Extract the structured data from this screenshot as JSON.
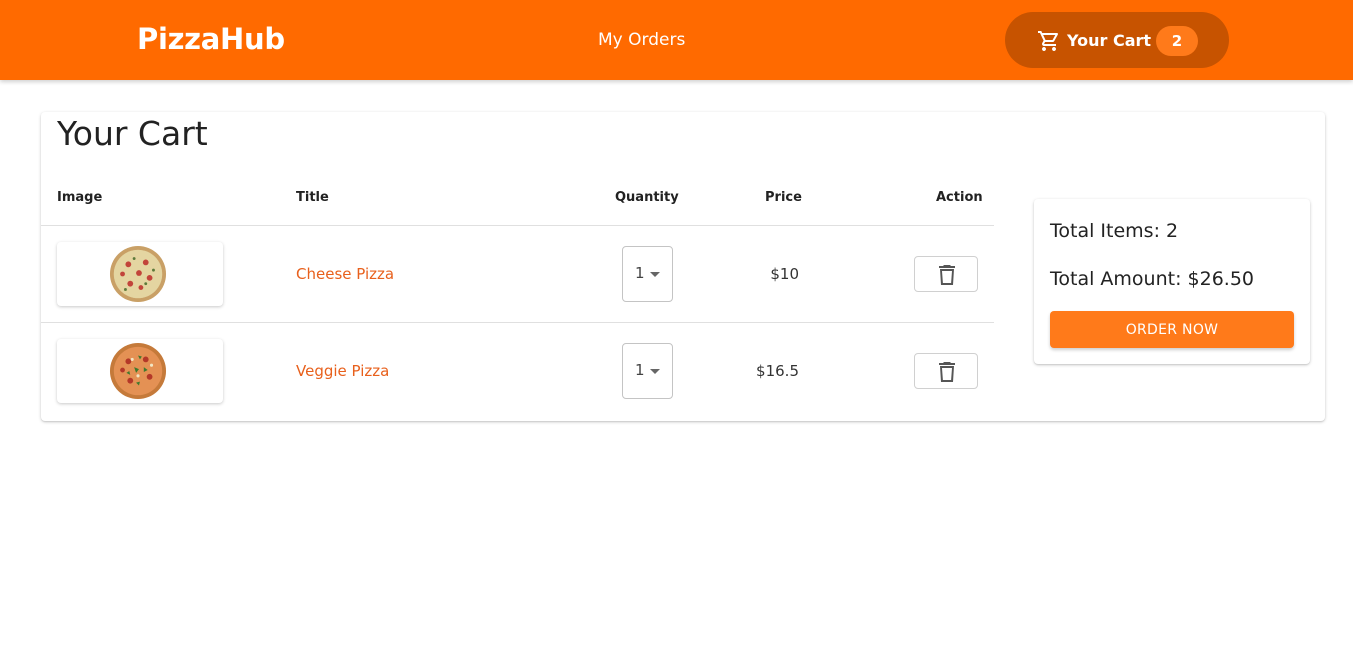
{
  "nav": {
    "brand": "PizzaHub",
    "my_orders": "My Orders",
    "cart_label": "Your Cart",
    "cart_count": "2",
    "cart_icon": "cart-icon",
    "accent_color": "#ff6a00"
  },
  "page": {
    "title": "Your Cart"
  },
  "table": {
    "headers": {
      "image": "Image",
      "title": "Title",
      "quantity": "Quantity",
      "price": "Price",
      "action": "Action"
    },
    "rows": [
      {
        "title": "Cheese Pizza",
        "quantity": "1",
        "price": "$10",
        "action_icon": "trash-icon",
        "image_icon": "pizza-image"
      },
      {
        "title": "Veggie Pizza",
        "quantity": "1",
        "price": "$16.5",
        "action_icon": "trash-icon",
        "image_icon": "pizza-image"
      }
    ]
  },
  "summary": {
    "total_items": "Total Items: 2",
    "total_amount": "Total Amount: $26.50",
    "order_button": "ORDER NOW"
  }
}
